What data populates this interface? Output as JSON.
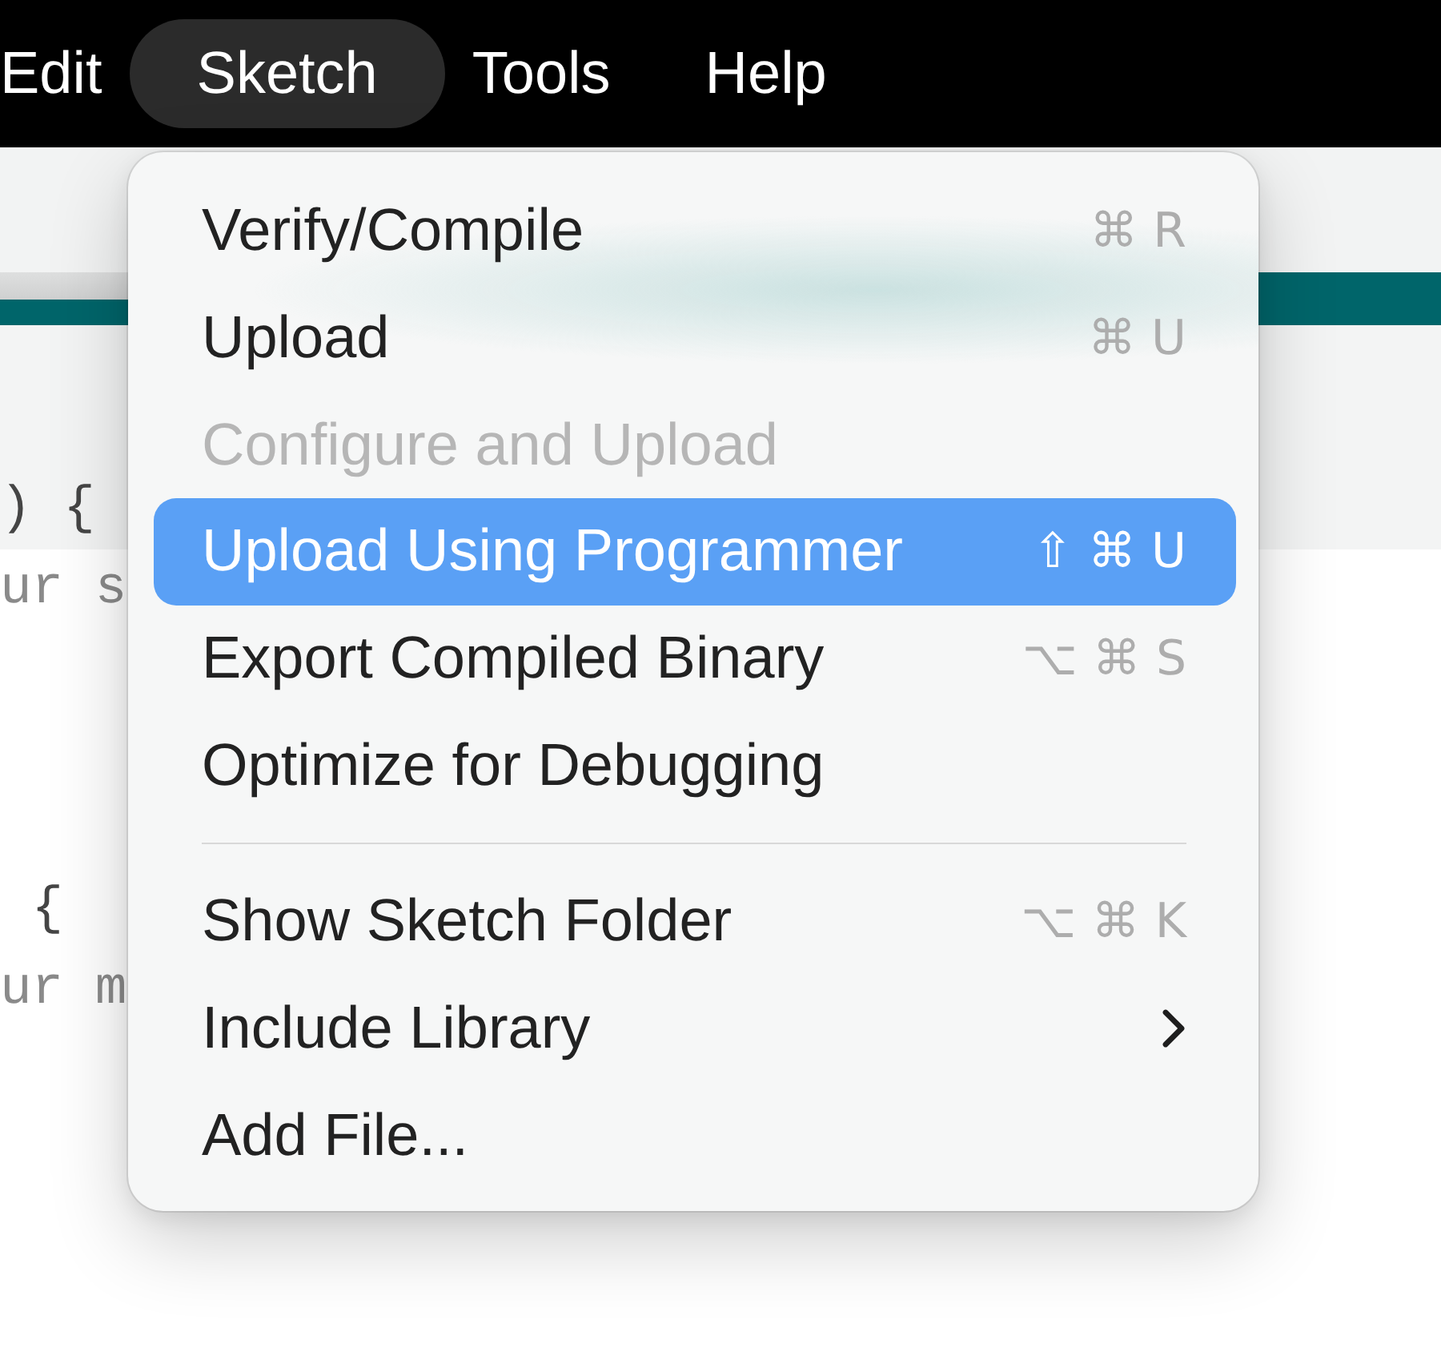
{
  "menu_bar": {
    "items": [
      {
        "label": "Edit",
        "selected": false
      },
      {
        "label": "Sketch",
        "selected": true
      },
      {
        "label": "Tools",
        "selected": false
      },
      {
        "label": "Help",
        "selected": false
      }
    ]
  },
  "editor": {
    "code_blocks": [
      {
        "lines": [
          {
            "text": ") {",
            "kind": "code",
            "highlighted": true
          },
          {
            "text": "ur s",
            "kind": "comment",
            "highlighted": false
          }
        ]
      },
      {
        "lines": [
          {
            "text": " {",
            "kind": "code",
            "highlighted": false
          },
          {
            "text": "ur m",
            "kind": "comment",
            "highlighted": false
          }
        ]
      }
    ]
  },
  "menu": {
    "sections": [
      {
        "items": [
          {
            "label": "Verify/Compile",
            "shortcut": "⌘ R",
            "disabled": false,
            "selected": false,
            "submenu": false
          },
          {
            "label": "Upload",
            "shortcut": "⌘ U",
            "disabled": false,
            "selected": false,
            "submenu": false
          },
          {
            "label": "Configure and Upload",
            "disabled": true,
            "selected": false,
            "submenu": false
          },
          {
            "label": "Upload Using Programmer",
            "shortcut": "⇧ ⌘ U",
            "disabled": false,
            "selected": true,
            "submenu": false
          },
          {
            "label": "Export Compiled Binary",
            "shortcut": "⌥ ⌘ S",
            "disabled": false,
            "selected": false,
            "submenu": false
          },
          {
            "label": "Optimize for Debugging",
            "disabled": false,
            "selected": false,
            "submenu": false
          }
        ]
      },
      {
        "items": [
          {
            "label": "Show Sketch Folder",
            "shortcut": "⌥ ⌘ K",
            "disabled": false,
            "selected": false,
            "submenu": false
          },
          {
            "label": "Include Library",
            "disabled": false,
            "selected": false,
            "submenu": true
          },
          {
            "label": "Add File...",
            "disabled": false,
            "selected": false,
            "submenu": false
          }
        ]
      }
    ]
  }
}
